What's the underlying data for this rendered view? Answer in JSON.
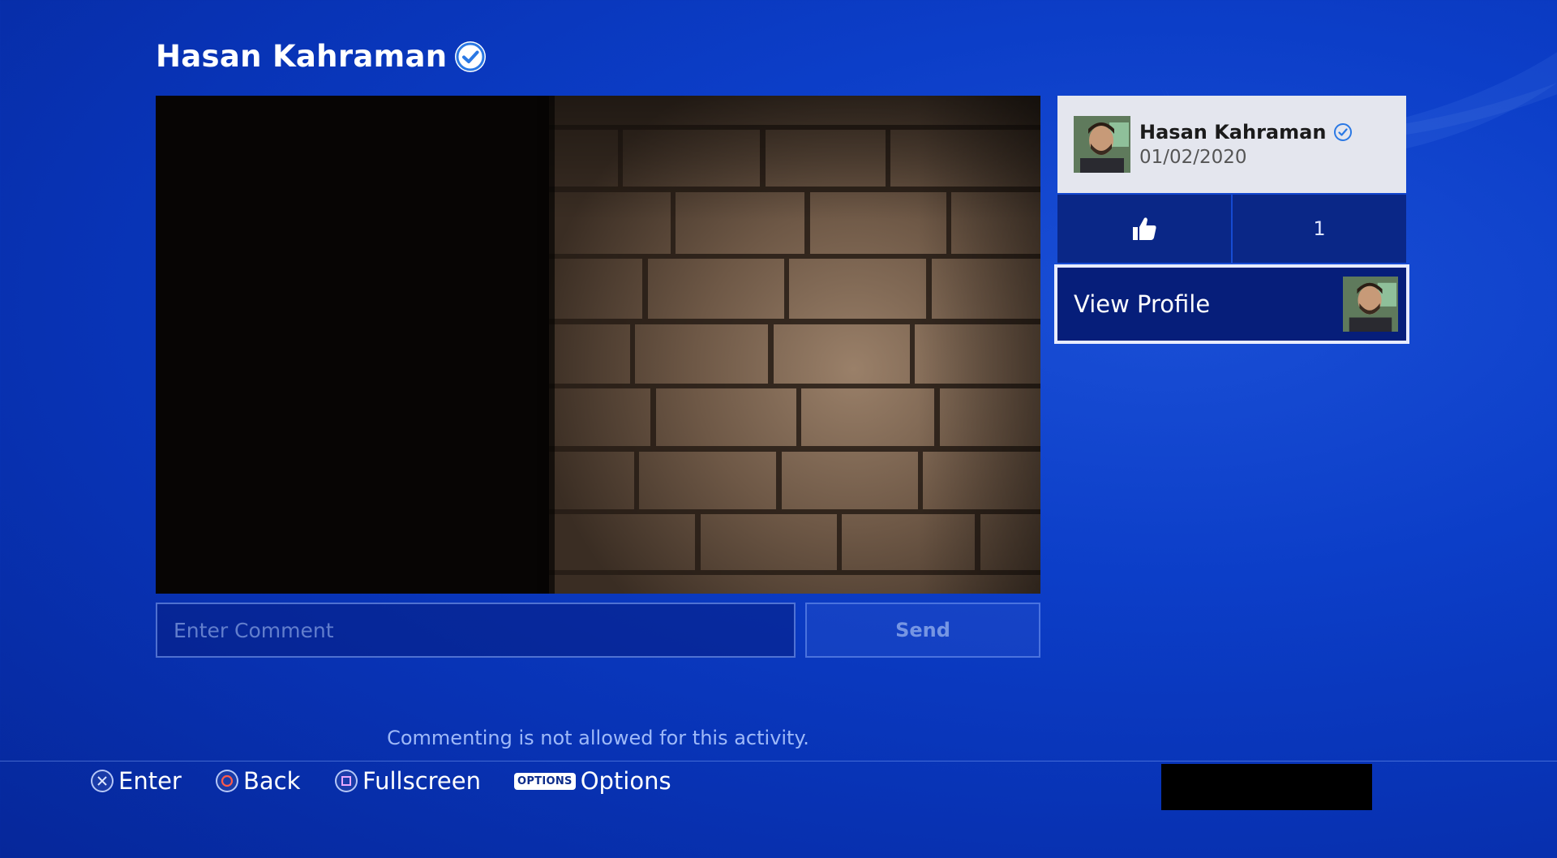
{
  "header": {
    "title": "Hasan Kahraman"
  },
  "post": {
    "user_name": "Hasan Kahraman",
    "date": "01/02/2020",
    "like_count": "1"
  },
  "actions": {
    "view_profile_label": "View Profile"
  },
  "comment": {
    "placeholder": "Enter Comment",
    "send_label": "Send",
    "notice": "Commenting is not allowed for this activity."
  },
  "footer": {
    "enter_label": "Enter",
    "back_label": "Back",
    "fullscreen_label": "Fullscreen",
    "options_badge": "OPTIONS",
    "options_label": "Options"
  },
  "colors": {
    "background": "#0a3bc4",
    "card_background": "#e4e6ee",
    "like_tile": "#0a2787",
    "focus_border": "#e8ecff",
    "verified_blue": "#2a78e4"
  },
  "icons": {
    "title_verified": "verified-check-icon",
    "like": "thumbs-up-icon",
    "enter": "cross-button-icon",
    "back": "circle-button-icon",
    "fullscreen": "square-button-icon"
  }
}
